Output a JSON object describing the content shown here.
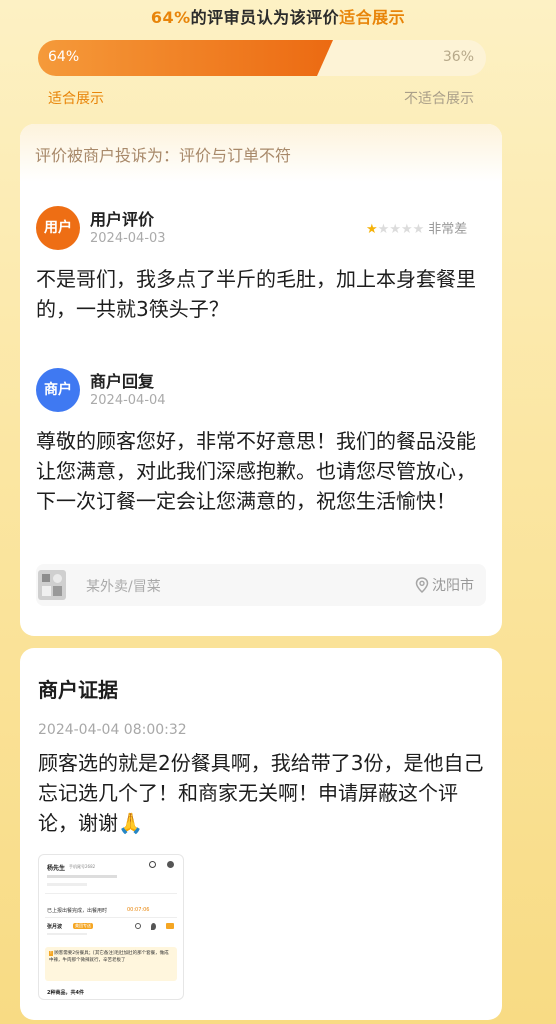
{
  "summary": {
    "percent": "64%",
    "middle": "的评审员认为该评价",
    "highlight": "适合展示",
    "suitable_pct": "64%",
    "unsuitable_pct": "36%",
    "suitable_fraction": 0.64,
    "suitable_label": "适合展示",
    "unsuitable_label": "不适合展示"
  },
  "complaint": {
    "header": "评价被商户投诉为：评价与订单不符"
  },
  "user_review": {
    "avatar": "用户",
    "title": "用户评价",
    "date": "2024-04-03",
    "rating": 1,
    "rating_max": 5,
    "rating_text": "非常差",
    "text": "不是哥们，我多点了半斤的毛肚，加上本身套餐里的，一共就3筷头子？"
  },
  "merchant_reply": {
    "avatar": "商户",
    "title": "商户回复",
    "date": "2024-04-04",
    "text": "尊敬的顾客您好，非常不好意思！我们的餐品没能让您满意，对此我们深感抱歉。也请您尽管放心，下一次订餐一定会让您满意的，祝您生活愉快！"
  },
  "shop": {
    "name": "某外卖/冒菜",
    "location": "沈阳市"
  },
  "evidence": {
    "title": "商户证据",
    "time": "2024-04-04 08:00:32",
    "text": "顾客选的就是2份餐具啊，我给带了3份，是他自己忘记选几个了！和商家无关啊！申请屏蔽这个评论，谢谢🙏",
    "thumb": {
      "customer": "杨先生",
      "phone_suffix": "手机尾号2682",
      "status": "已上报出餐完成，出餐用时",
      "duration": "00:07:06",
      "rider": "张月波",
      "rider_tag": "美团专送",
      "note": "顾客需要2份餐具；[其它备注]毛肚加肚的那个套餐，做成中辣，牛肉那个微辣就行，辛苦老板了",
      "items": "2种商品，共4件"
    }
  }
}
